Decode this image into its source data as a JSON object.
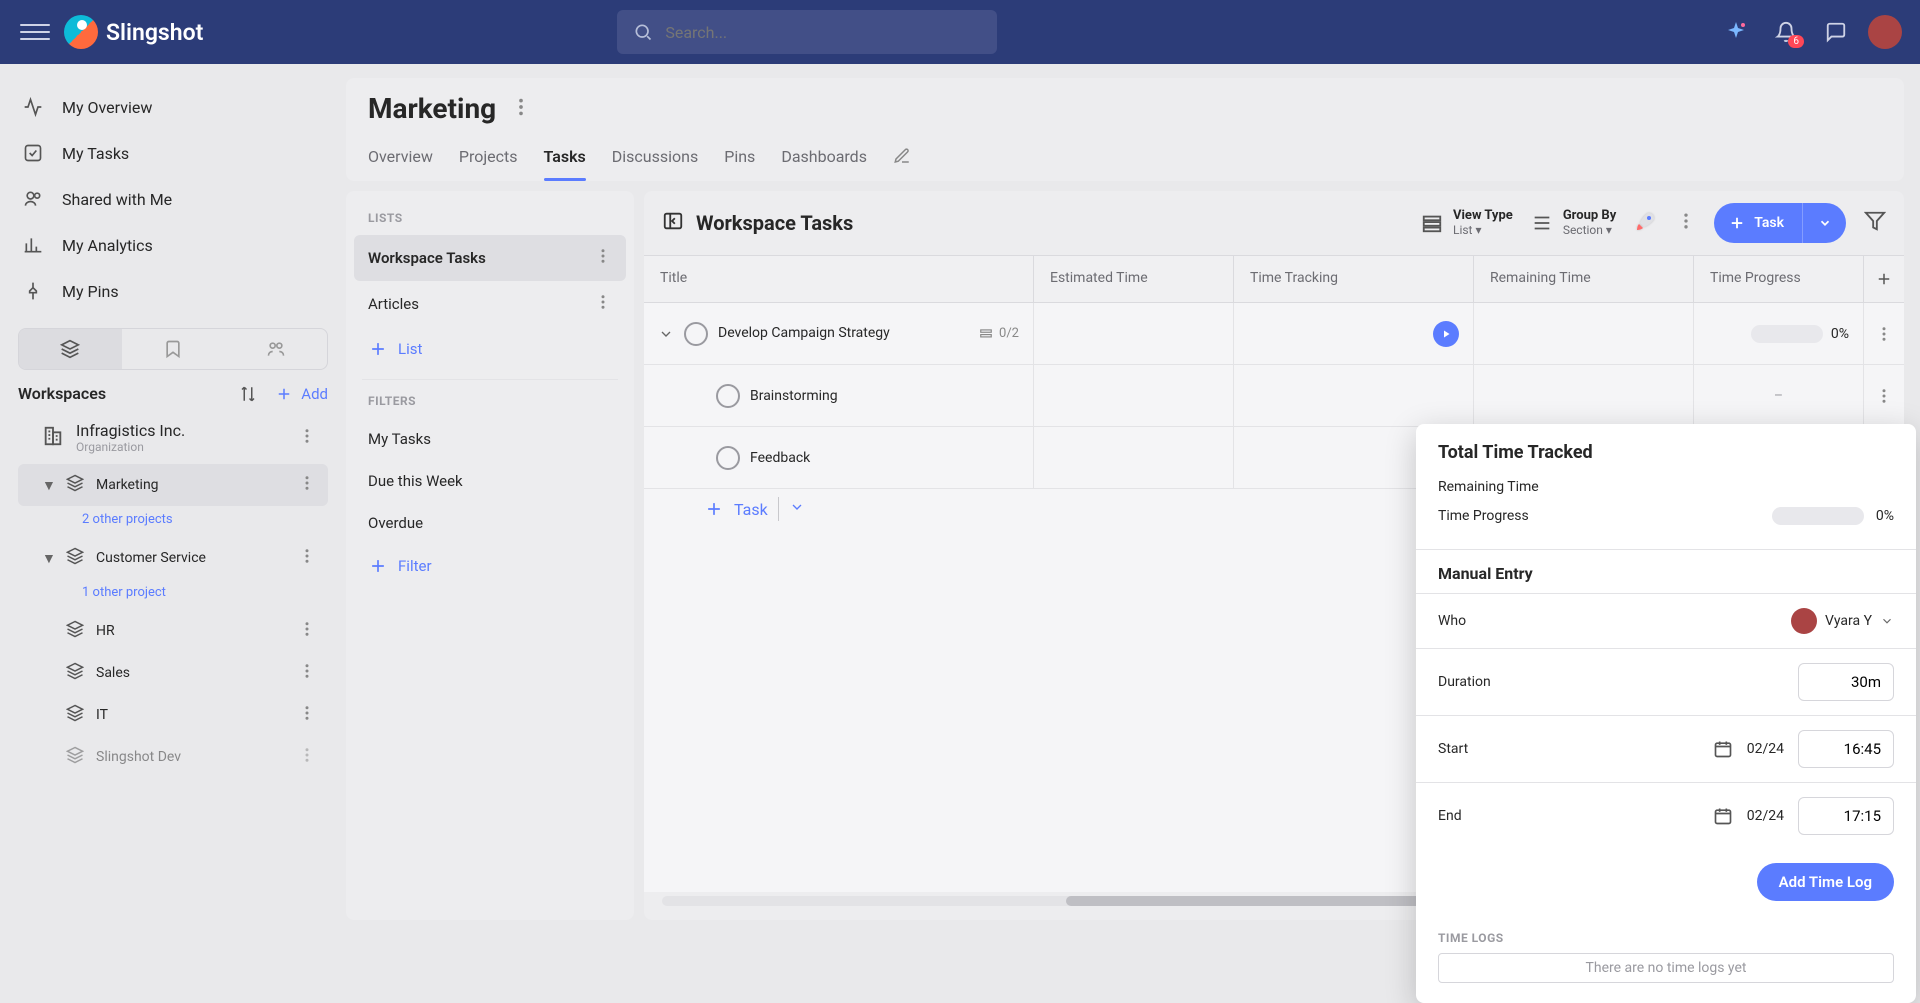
{
  "app": {
    "name": "Slingshot",
    "search_placeholder": "Search...",
    "notif_count": "6"
  },
  "sidebar": {
    "items": [
      {
        "label": "My Overview",
        "icon": "activity"
      },
      {
        "label": "My Tasks",
        "icon": "check-square"
      },
      {
        "label": "Shared with Me",
        "icon": "users"
      },
      {
        "label": "My Analytics",
        "icon": "bar-chart"
      },
      {
        "label": "My Pins",
        "icon": "pin"
      }
    ],
    "workspaces_label": "Workspaces",
    "add_label": "Add",
    "org": {
      "name": "Infragistics Inc.",
      "subtitle": "Organization"
    },
    "tree": [
      {
        "name": "Marketing",
        "sub": "2 other projects",
        "active": true,
        "expanded": true
      },
      {
        "name": "Customer Service",
        "sub": "1 other project",
        "expanded": true
      },
      {
        "name": "HR"
      },
      {
        "name": "Sales"
      },
      {
        "name": "IT"
      },
      {
        "name": "Slingshot Dev"
      }
    ]
  },
  "page": {
    "title": "Marketing",
    "tabs": [
      "Overview",
      "Projects",
      "Tasks",
      "Discussions",
      "Pins",
      "Dashboards"
    ],
    "active_tab": "Tasks"
  },
  "lists_panel": {
    "section1": "LISTS",
    "lists": [
      "Workspace Tasks",
      "Articles"
    ],
    "active_list": "Workspace Tasks",
    "add_list": "List",
    "section2": "FILTERS",
    "filters": [
      "My Tasks",
      "Due this Week",
      "Overdue"
    ],
    "add_filter": "Filter"
  },
  "tasks": {
    "title": "Workspace Tasks",
    "view_type": {
      "label": "View Type",
      "value": "List"
    },
    "group_by": {
      "label": "Group By",
      "value": "Section"
    },
    "task_btn": "Task",
    "columns": [
      "Title",
      "Estimated Time",
      "Time Tracking",
      "Remaining Time",
      "Time Progress"
    ],
    "rows": [
      {
        "title": "Develop Campaign Strategy",
        "checklist": "0/2",
        "play": true,
        "progress": "0%",
        "parent": true
      },
      {
        "title": "Brainstorming",
        "dash": true
      },
      {
        "title": "Feedback",
        "dash": true
      }
    ],
    "add_row": "Task"
  },
  "popover": {
    "title": "Total Time Tracked",
    "remaining_label": "Remaining Time",
    "progress_label": "Time Progress",
    "progress_value": "0%",
    "manual_entry": "Manual Entry",
    "who_label": "Who",
    "who_value": "Vyara Y",
    "duration_label": "Duration",
    "duration_value": "30m",
    "start_label": "Start",
    "start_date": "02/24",
    "start_time": "16:45",
    "end_label": "End",
    "end_date": "02/24",
    "end_time": "17:15",
    "add_btn": "Add Time Log",
    "logs_label": "TIME LOGS",
    "empty": "There are no time logs yet"
  }
}
